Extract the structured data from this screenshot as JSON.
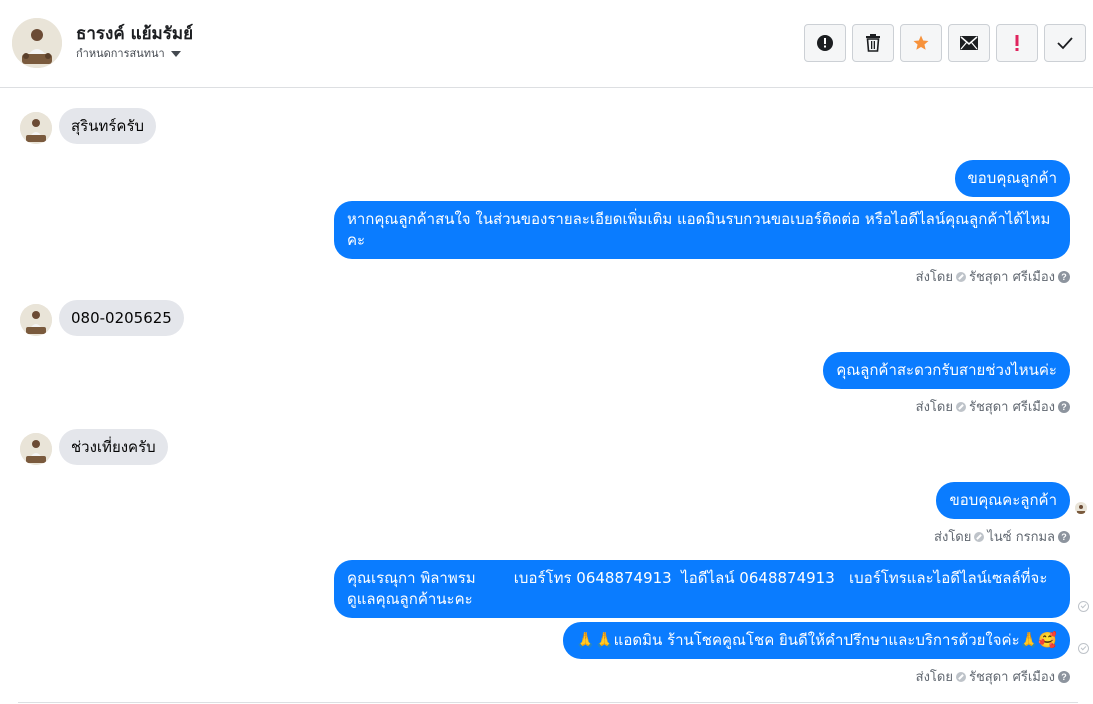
{
  "header": {
    "name": "ธารงค์ แย้มรัมย์",
    "subtitle": "กำหนดการสนทนา"
  },
  "toolbar": [
    {
      "name": "report-spam-icon",
      "label": "!"
    },
    {
      "name": "delete-icon",
      "label": "🗑"
    },
    {
      "name": "star-icon",
      "label": "★"
    },
    {
      "name": "mail-icon",
      "label": "✉"
    },
    {
      "name": "important-icon",
      "label": "!"
    },
    {
      "name": "done-icon",
      "label": "✓"
    }
  ],
  "messages": {
    "m1": "สุรินทร์ครับ",
    "m2": "ขอบคุณลูกค้า",
    "m3": "หากคุณลูกค้าสนใจ ในส่วนของรายละเอียดเพิ่มเติม แอดมินรบกวนขอเบอร์ติดต่อ หรือไอดีไลน์คุณลูกค้าได้ไหมคะ",
    "m4": "080-0205625",
    "m5": "คุณลูกค้าสะดวกรับสายช่วงไหนค่ะ",
    "m6": "ช่วงเที่ยงครับ",
    "m7": "ขอบคุณคะลูกค้า",
    "m8": "คุณเรณุกา พิลาพรม        เบอร์โทร 0648874913  ไอดีไลน์ 0648874913   เบอร์โทรและไอดีไลน์เซลล์ที่จะดูแลคุณลูกค้านะคะ",
    "m9": "🙏🙏แอดมิน ร้านโชคคูณโชค ยินดีให้คำปรึกษาและบริการด้วยใจค่ะ🙏🥰"
  },
  "sent_by": {
    "prefix": "ส่งโดย",
    "agent1": "รัชสุดา ศรีเมือง",
    "agent2": "ไนซ์ กรกมล"
  },
  "colors": {
    "outgoing": "#0a7cff",
    "incoming": "#e4e6eb",
    "star": "#f7923b",
    "important": "#e0245e"
  }
}
